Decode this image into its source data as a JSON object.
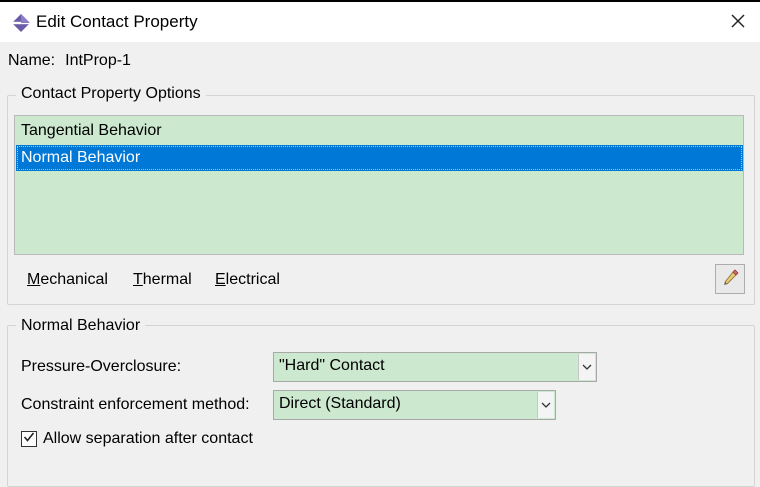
{
  "window": {
    "title": "Edit Contact Property"
  },
  "name": {
    "label": "Name:",
    "value": "IntProp-1"
  },
  "options_group": {
    "title": "Contact Property Options",
    "items": [
      {
        "label": "Tangential Behavior",
        "selected": false
      },
      {
        "label": "Normal Behavior",
        "selected": true
      }
    ],
    "tabs": [
      {
        "label": "Mechanical",
        "mnemonic": "M"
      },
      {
        "label": "Thermal",
        "mnemonic": "T"
      },
      {
        "label": "Electrical",
        "mnemonic": "E"
      }
    ]
  },
  "behavior_group": {
    "title": "Normal Behavior",
    "pressure": {
      "label": "Pressure-Overclosure:",
      "value": "\"Hard\" Contact"
    },
    "constraint": {
      "label": "Constraint enforcement method:",
      "value": "Direct (Standard)"
    },
    "separation": {
      "label": "Allow separation after contact",
      "checked": true
    }
  },
  "colors": {
    "list_bg": "#cce8cf",
    "selection": "#0078d7",
    "dialog_bg": "#f0f0f0"
  },
  "icons": {
    "title": "abaqus-diamond-icon",
    "close": "close-icon",
    "edit": "pencil-edit-icon",
    "dropdown": "chevron-down-icon",
    "check": "checkmark-icon"
  }
}
